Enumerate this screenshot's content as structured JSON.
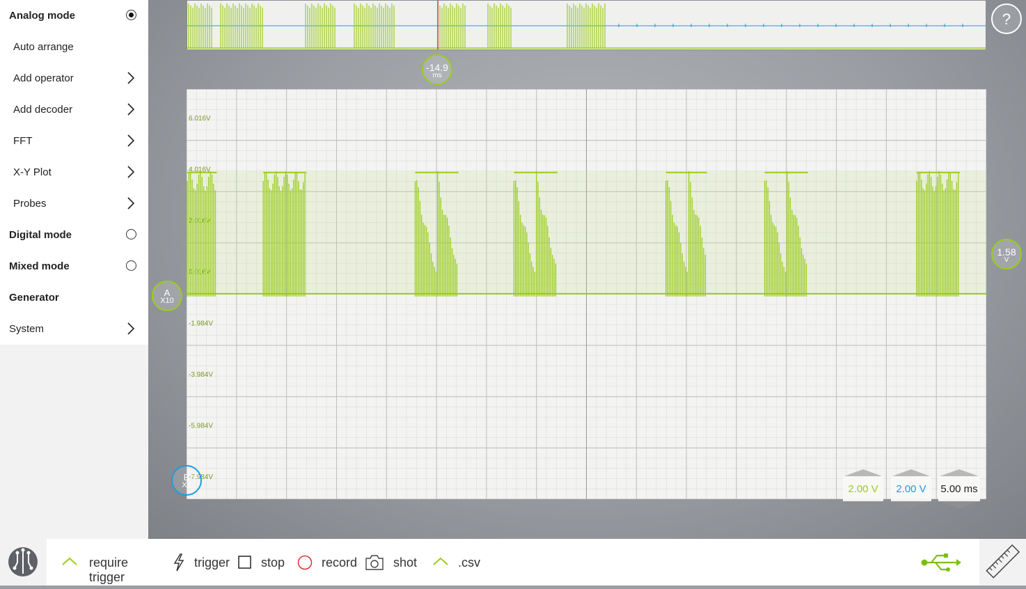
{
  "sidebar": {
    "items": [
      {
        "label": "Analog mode",
        "kind": "main",
        "control": "radio-on"
      },
      {
        "label": "Auto arrange",
        "kind": "sub",
        "control": "none"
      },
      {
        "label": "Add operator",
        "kind": "sub",
        "control": "chevron"
      },
      {
        "label": "Add decoder",
        "kind": "sub",
        "control": "chevron"
      },
      {
        "label": "FFT",
        "kind": "sub",
        "control": "chevron"
      },
      {
        "label": "X-Y Plot",
        "kind": "sub",
        "control": "chevron"
      },
      {
        "label": "Probes",
        "kind": "sub",
        "control": "chevron"
      },
      {
        "label": "Digital mode",
        "kind": "main",
        "control": "radio-off"
      },
      {
        "label": "Mixed mode",
        "kind": "main",
        "control": "radio-off"
      },
      {
        "label": "Generator",
        "kind": "main",
        "control": "none"
      },
      {
        "label": "System",
        "kind": "main-plain",
        "control": "chevron"
      }
    ]
  },
  "help": {
    "label": "?"
  },
  "time_cursor": {
    "value": "-14.9",
    "unit": "ms"
  },
  "channel_a": {
    "name": "A",
    "probe": "X10"
  },
  "channel_b": {
    "name": "B",
    "probe": "X1"
  },
  "trigger_level": {
    "value": "1.58",
    "unit": "V"
  },
  "scope": {
    "volt_labels": [
      "6.016V",
      "4.016V",
      "2.016V",
      "0.016V",
      "-1.984V",
      "-3.984V",
      "-5.984V",
      "-7.984V"
    ]
  },
  "scales": {
    "ch_a": "2.00 V",
    "ch_b": "2.00 V",
    "time": "5.00 ms"
  },
  "toolbar": {
    "require_trigger": "require trigger",
    "trigger": "trigger",
    "stop": "stop",
    "record": "record",
    "shot": "shot",
    "csv": ".csv"
  },
  "colors": {
    "signal": "#9acd1a",
    "channel_b": "#1e9be0",
    "record": "#e23030",
    "cursor": "#c04a1a"
  },
  "chart_data": {
    "type": "line",
    "series": [
      {
        "values": [
          {
            "t": 0.0,
            "w": 0.065,
            "top": 4.8,
            "decay": false
          },
          {
            "t": 0.1,
            "w": 0.095,
            "top": 4.8,
            "decay": false
          },
          {
            "t": 0.3,
            "w": 0.095,
            "top": 4.8,
            "decay": true
          },
          {
            "t": 0.43,
            "w": 0.095,
            "top": 4.8,
            "decay": true
          },
          {
            "t": 0.63,
            "w": 0.09,
            "top": 4.8,
            "decay": true
          },
          {
            "t": 0.76,
            "w": 0.095,
            "top": 4.8,
            "decay": true
          },
          {
            "t": 0.96,
            "w": 0.095,
            "top": 4.8,
            "decay": false
          }
        ]
      }
    ],
    "ylim": [
      -8,
      8
    ],
    "baseline": 0.016
  }
}
